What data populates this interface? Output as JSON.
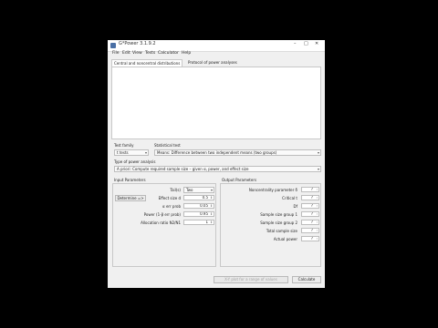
{
  "window": {
    "title": "G*Power 3.1.9.2"
  },
  "menu": [
    "File",
    "Edit",
    "View",
    "Tests",
    "Calculator",
    "Help"
  ],
  "tabs": [
    "Central and noncentral distributions",
    "Protocol of power analyses"
  ],
  "test_family": {
    "label": "Test family",
    "value": "t tests"
  },
  "statistical_test": {
    "label": "Statistical test",
    "value": "Means: Difference between two independent means (two groups)"
  },
  "type_of_power_analysis": {
    "label": "Type of power analysis",
    "value": "A priori: Compute required sample size – given α, power, and effect size"
  },
  "input": {
    "title": "Input Parameters",
    "tails_label": "Tail(s)",
    "tails_value": "Two",
    "determine_label": "Determine =>",
    "effect_size_label": "Effect size d",
    "effect_size": "0.5",
    "alpha_label": "α err prob",
    "alpha": "0.05",
    "power_label": "Power (1-β err prob)",
    "power": "0.95",
    "allocation_label": "Allocation ratio N2/N1",
    "allocation": "1"
  },
  "output": {
    "title": "Output Parameters",
    "ncp_label": "Noncentrality parameter δ",
    "ncp": "?",
    "critical_label": "Critical t",
    "critical": "?",
    "df_label": "Df",
    "df": "?",
    "n1_label": "Sample size group 1",
    "n1": "?",
    "n2_label": "Sample size group 2",
    "n2": "?",
    "total_label": "Total sample size",
    "total": "?",
    "actual_power_label": "Actual power",
    "actual_power": "?"
  },
  "buttons": {
    "plot": "X-Y plot for a range of values",
    "calculate": "Calculate"
  },
  "icons": {
    "minimize": "minimize-icon",
    "maximize": "maximize-icon",
    "close": "close-icon",
    "dropdown": "chevron-down-icon"
  }
}
